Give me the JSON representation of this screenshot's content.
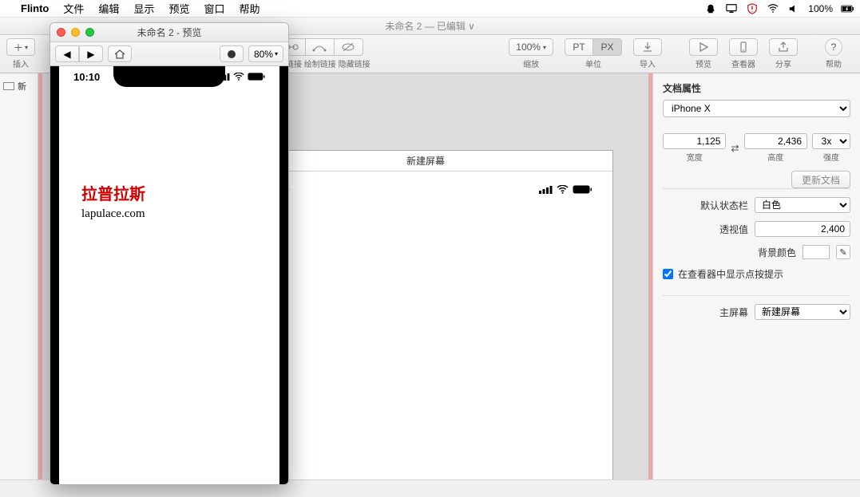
{
  "menubar": {
    "app": "Flinto",
    "items": [
      "文件",
      "编辑",
      "显示",
      "预览",
      "窗口",
      "帮助"
    ],
    "battery": "100%"
  },
  "mainwin": {
    "title": "未命名 2 — 已编辑",
    "toolbar": {
      "insert": "插入",
      "create_link": "创建链接",
      "draw_link": "绘制链接",
      "hide_link": "隐藏链接",
      "zoom_value": "100%",
      "zoom_label": "缩放",
      "unit_pt": "PT",
      "unit_px": "PX",
      "unit_label": "单位",
      "import": "导入",
      "preview": "预览",
      "viewer": "查看器",
      "share": "分享",
      "help": "帮助"
    },
    "rail_item": "新"
  },
  "screen": {
    "title": "新建屏幕",
    "time": "10:10"
  },
  "inspector": {
    "title": "文档属性",
    "device": "iPhone X",
    "width": "1,125",
    "width_lbl": "宽度",
    "height": "2,436",
    "height_lbl": "高度",
    "intensity": "3x",
    "intensity_lbl": "强度",
    "update": "更新文档",
    "statusbar_lbl": "默认状态栏",
    "statusbar_val": "白色",
    "perspective_lbl": "透视值",
    "perspective_val": "2,400",
    "bgcolor_lbl": "背景颜色",
    "hint": "在查看器中显示点按提示",
    "mainscreen_lbl": "主屏幕",
    "mainscreen_val": "新建屏幕"
  },
  "preview": {
    "title": "未命名 2 - 预览",
    "zoom": "80%",
    "time": "10:10",
    "watermark_zh": "拉普拉斯",
    "watermark_en": "lapulace.com"
  }
}
